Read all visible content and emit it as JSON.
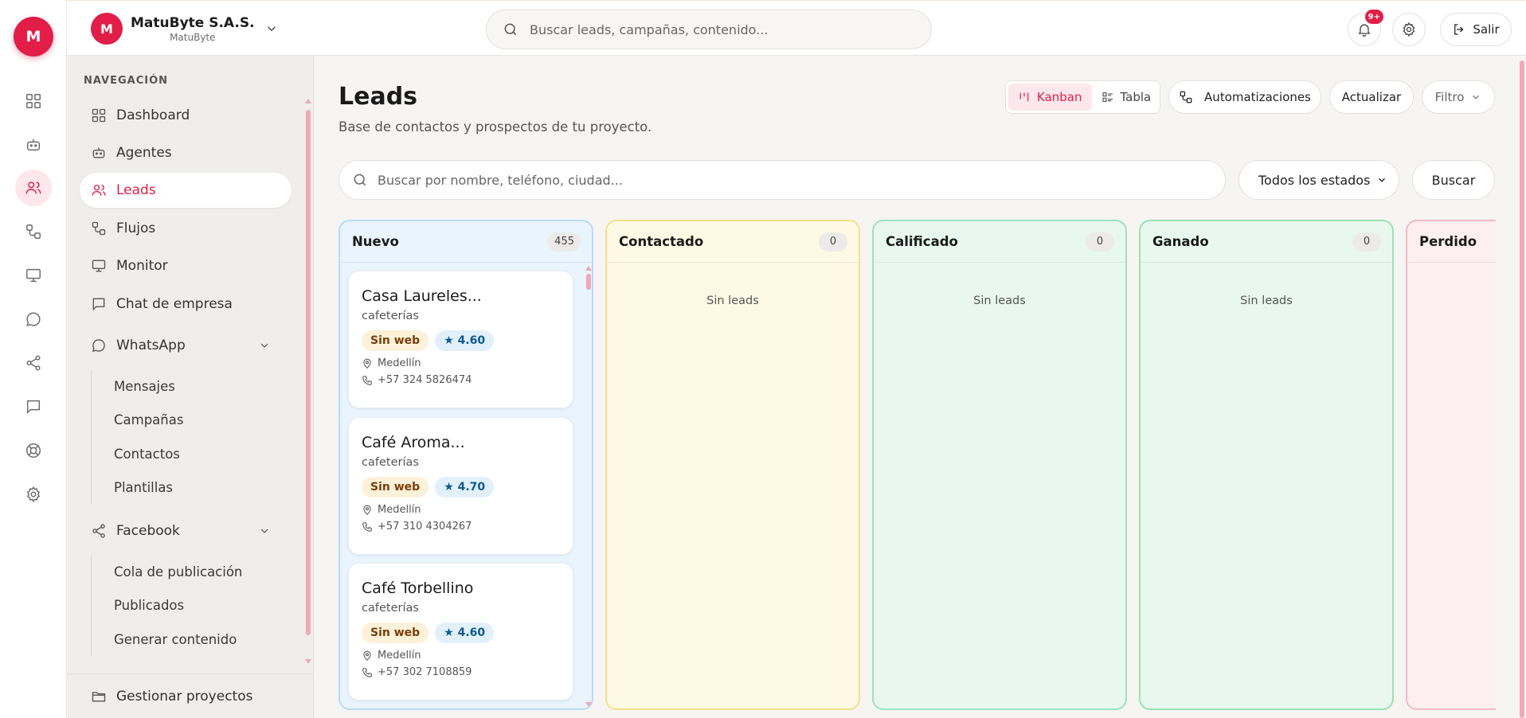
{
  "rail": {
    "logo": "M",
    "items": [
      "grid-icon",
      "bot-icon",
      "users-icon",
      "workflow-icon",
      "monitor-icon",
      "chat-icon",
      "share-icon",
      "message-square-icon",
      "help-icon",
      "gear-icon"
    ]
  },
  "header": {
    "project_avatar": "M",
    "project_name": "MatuByte S.A.S.",
    "project_sub": "MatuByte",
    "search_placeholder": "Buscar leads, campañas, contenido...",
    "notif_badge": "9+",
    "logout_label": "Salir"
  },
  "sidebar": {
    "heading": "NAVEGACIÓN",
    "items": [
      {
        "label": "Dashboard",
        "icon": "grid-icon"
      },
      {
        "label": "Agentes",
        "icon": "bot-icon"
      },
      {
        "label": "Leads",
        "icon": "users-icon"
      },
      {
        "label": "Flujos",
        "icon": "workflow-icon"
      },
      {
        "label": "Monitor",
        "icon": "monitor-icon"
      },
      {
        "label": "Chat de empresa",
        "icon": "message-square-icon"
      },
      {
        "label": "WhatsApp",
        "icon": "chat-icon"
      },
      {
        "label": "Facebook",
        "icon": "share-icon"
      }
    ],
    "whatsapp_sub": [
      "Mensajes",
      "Campañas",
      "Contactos",
      "Plantillas"
    ],
    "facebook_sub": [
      "Cola de publicación",
      "Publicados",
      "Generar contenido"
    ],
    "bottom_item": "Gestionar proyectos"
  },
  "main": {
    "title": "Leads",
    "subtitle": "Base de contactos y prospectos de tu proyecto.",
    "view_kanban": "Kanban",
    "view_table": "Tabla",
    "automations_label": "Automatizaciones",
    "refresh_label": "Actualizar",
    "filter_label": "Filtro",
    "search_placeholder": "Buscar por nombre, teléfono, ciudad...",
    "state_select": "Todos los estados",
    "search_button": "Buscar"
  },
  "kanban": {
    "empty_text": "Sin leads",
    "columns": [
      {
        "title": "Nuevo",
        "count": "455",
        "color": "#e9f4fd",
        "border": "#b9dcf5"
      },
      {
        "title": "Contactado",
        "count": "0",
        "color": "#fef9e4",
        "border": "#f7de8a"
      },
      {
        "title": "Calificado",
        "count": "0",
        "color": "#e8f8f1",
        "border": "#9fe2c2"
      },
      {
        "title": "Ganado",
        "count": "0",
        "color": "#e8f8ee",
        "border": "#9ae2b4"
      },
      {
        "title": "Perdido",
        "count": "",
        "color": "#fdeef0",
        "border": "#f5b8c3"
      }
    ],
    "cards": [
      {
        "name": "Casa Laureles...",
        "category": "cafeterías",
        "tag_web": "Sin web",
        "rating": "★ 4.60",
        "city": "Medellín",
        "phone": "+57 324 5826474"
      },
      {
        "name": "Café Aroma...",
        "category": "cafeterías",
        "tag_web": "Sin web",
        "rating": "★ 4.70",
        "city": "Medellín",
        "phone": "+57 310 4304267"
      },
      {
        "name": "Café Torbellino",
        "category": "cafeterías",
        "tag_web": "Sin web",
        "rating": "★ 4.60",
        "city": "Medellín",
        "phone": "+57 302 7108859"
      }
    ]
  }
}
